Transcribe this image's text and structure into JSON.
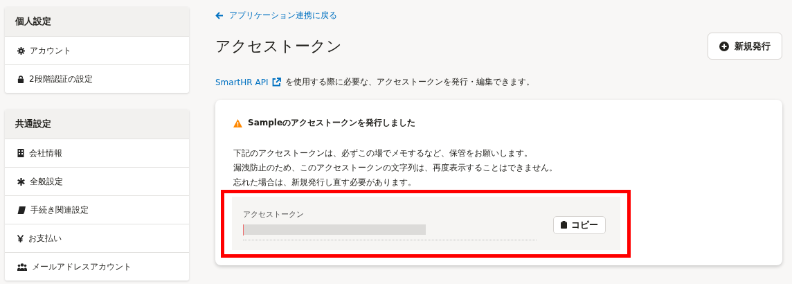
{
  "sidebar": {
    "panels": [
      {
        "title": "個人設定",
        "items": [
          {
            "label": "アカウント"
          },
          {
            "label": "2段階認証の設定"
          }
        ]
      },
      {
        "title": "共通設定",
        "items": [
          {
            "label": "会社情報"
          },
          {
            "label": "全般設定"
          },
          {
            "label": "手続き関連設定"
          },
          {
            "label": "お支払い"
          },
          {
            "label": "メールアドレスアカウント"
          }
        ]
      }
    ]
  },
  "back_link": "アプリケーション連携に戻る",
  "page_title": "アクセストークン",
  "new_button": "新規発行",
  "description": {
    "link": "SmartHR API",
    "text": "を使用する際に必要な、アクセストークンを発行・編集できます。"
  },
  "notice": {
    "title": "Sampleのアクセストークンを発行しました",
    "lines": [
      "下記のアクセストークンは、必ずこの場でメモするなど、保管をお願いします。",
      "漏洩防止のため、このアクセストークンの文字列は、再度表示することはできません。",
      "忘れた場合は、新規発行し直す必要があります。"
    ],
    "token_label": "アクセストークン",
    "copy_button": "コピー"
  }
}
